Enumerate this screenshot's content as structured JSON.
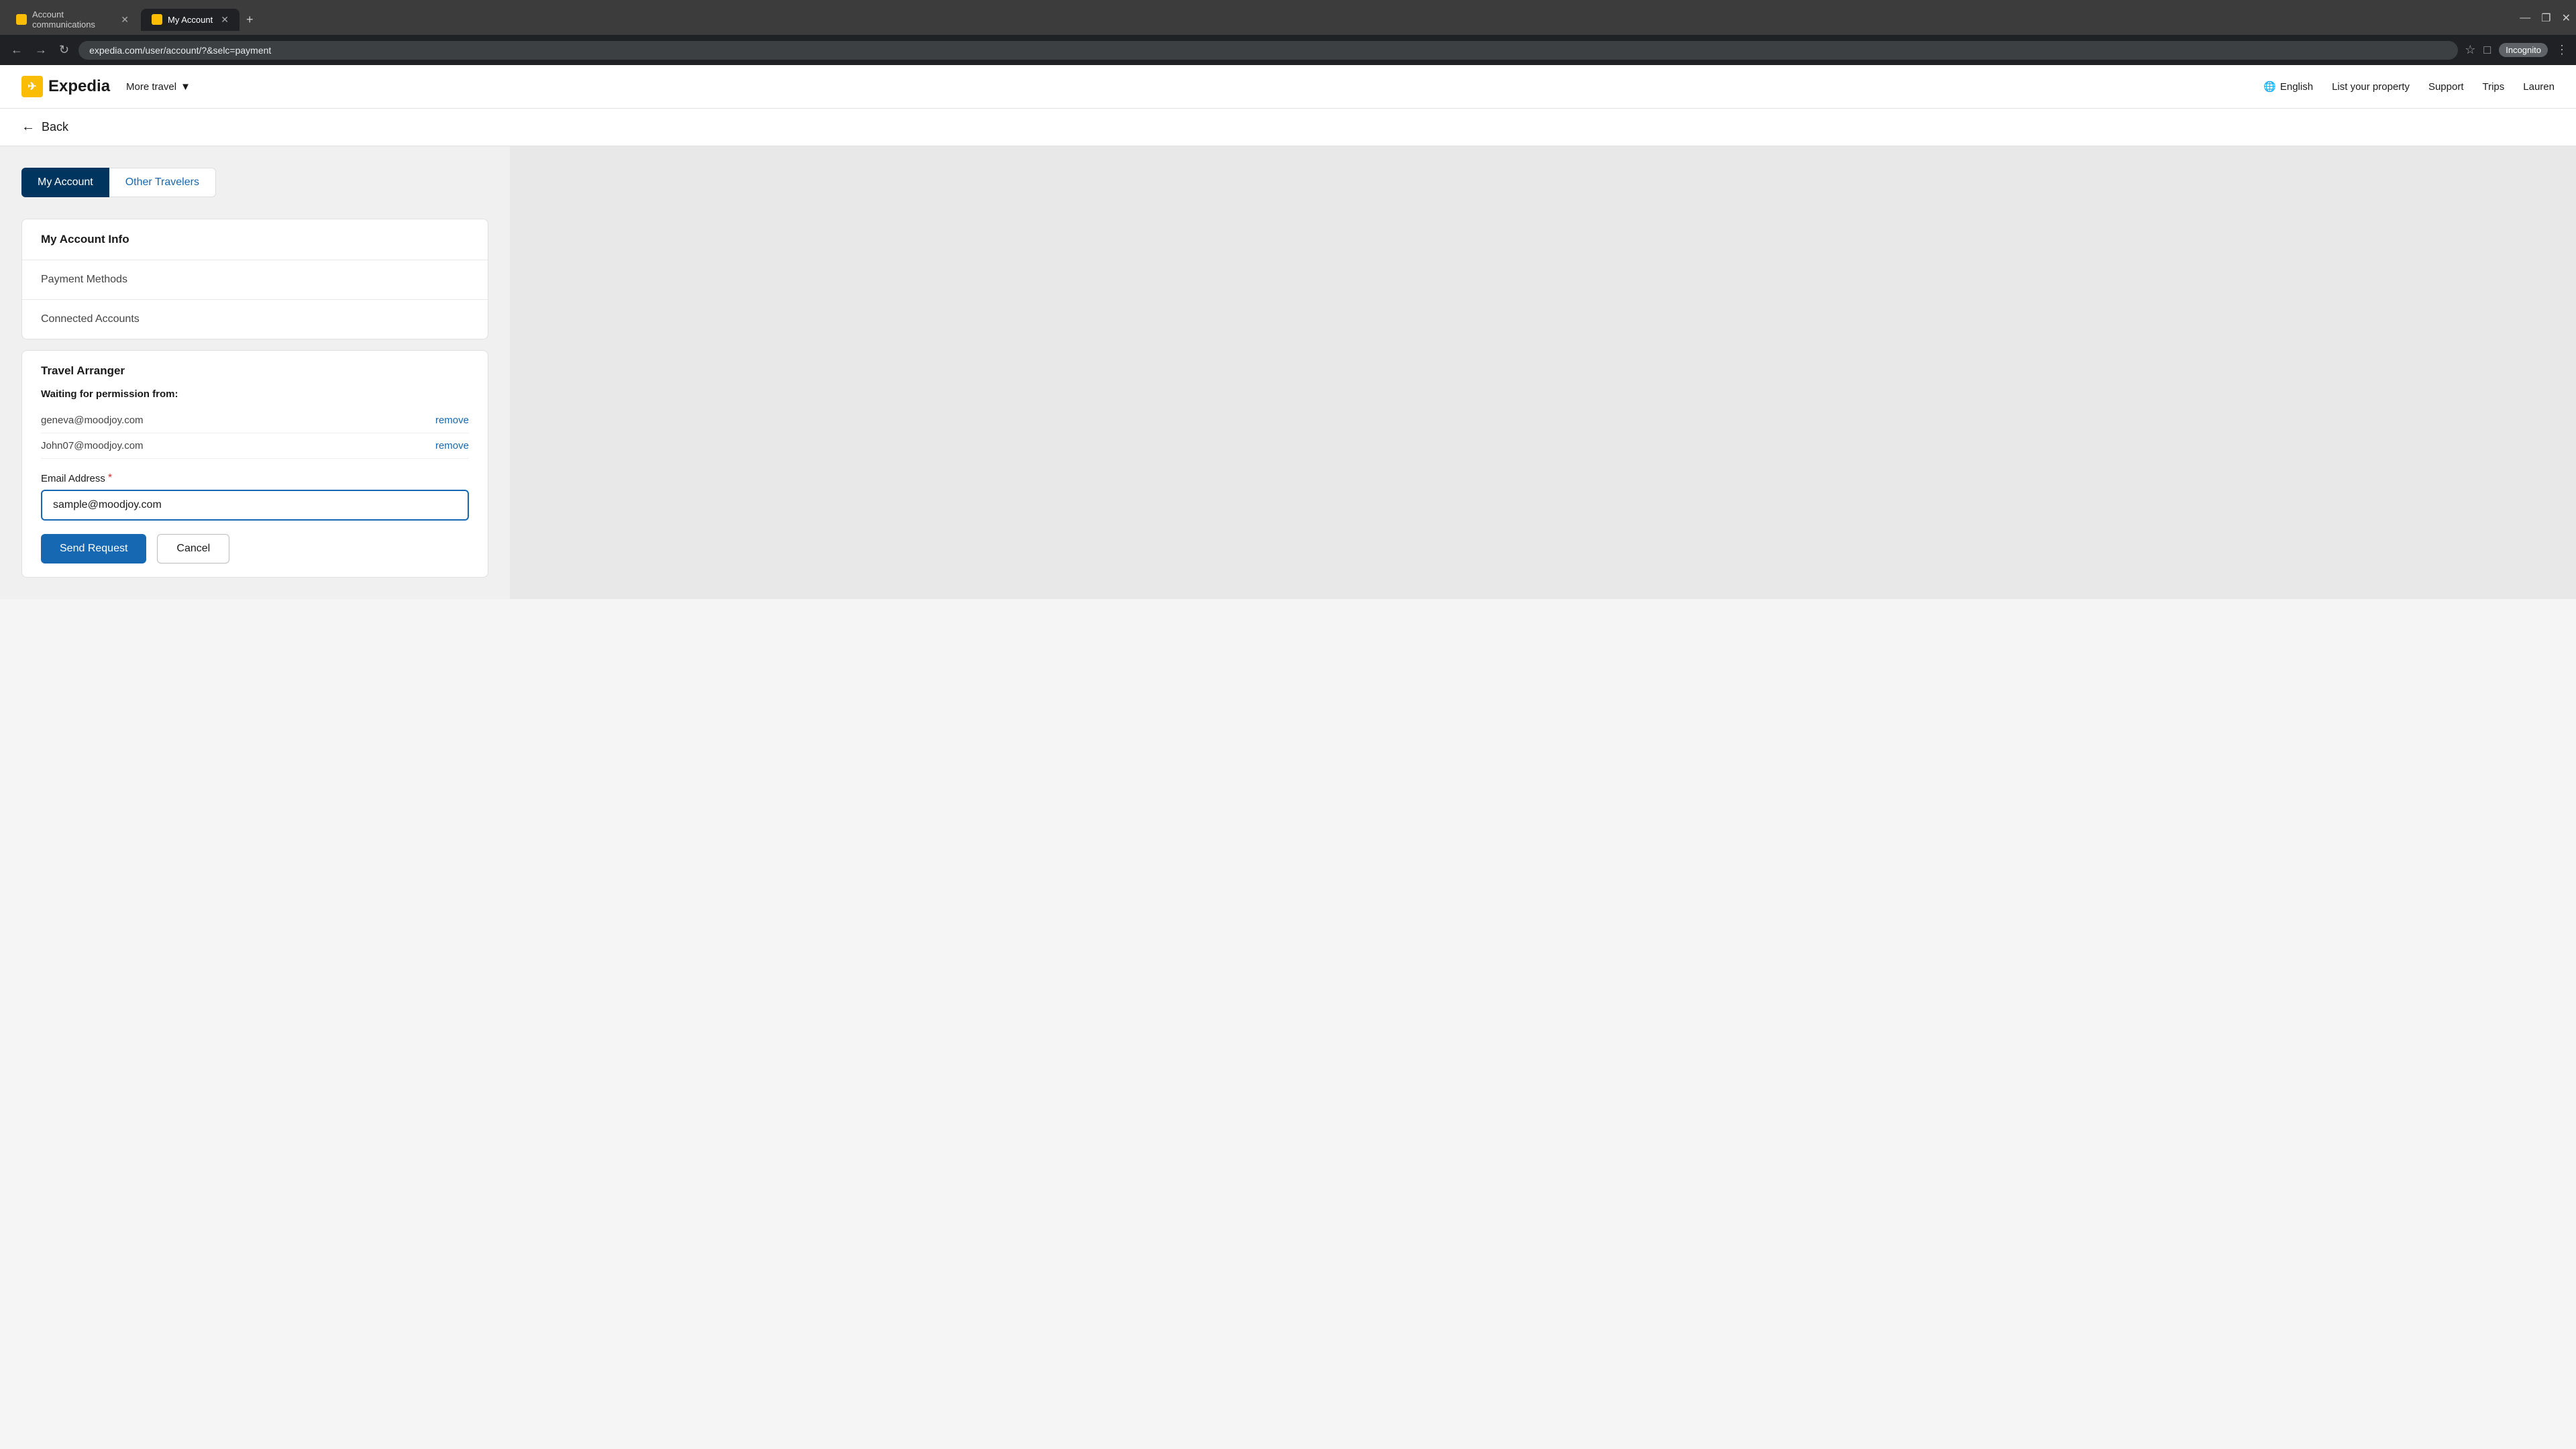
{
  "browser": {
    "tabs": [
      {
        "id": "tab1",
        "label": "Account communications",
        "active": false
      },
      {
        "id": "tab2",
        "label": "My Account",
        "active": true
      }
    ],
    "url": "expedia.com/user/account/?&selc=payment",
    "new_tab_label": "+",
    "incognito_label": "Incognito",
    "window_controls": {
      "minimize": "—",
      "restore": "❐",
      "close": "✕"
    }
  },
  "header": {
    "logo_text": "Expedia",
    "more_travel_label": "More travel",
    "nav_items": [
      {
        "id": "english",
        "label": "English",
        "has_globe": true
      },
      {
        "id": "list-property",
        "label": "List your property"
      },
      {
        "id": "support",
        "label": "Support"
      },
      {
        "id": "trips",
        "label": "Trips"
      },
      {
        "id": "account",
        "label": "Lauren"
      }
    ]
  },
  "back_bar": {
    "back_label": "Back"
  },
  "account_tabs": {
    "my_account_label": "My Account",
    "other_travelers_label": "Other Travelers"
  },
  "account_info": {
    "title": "My Account Info",
    "sections": [
      {
        "id": "payment",
        "label": "Payment Methods"
      },
      {
        "id": "connected",
        "label": "Connected Accounts"
      }
    ]
  },
  "travel_arranger": {
    "title": "Travel Arranger",
    "waiting_label": "Waiting for permission from:",
    "entries": [
      {
        "email": "geneva@moodjoy.com",
        "remove_label": "remove"
      },
      {
        "email": "John07@moodjoy.com",
        "remove_label": "remove"
      }
    ]
  },
  "email_form": {
    "label": "Email Address",
    "required_symbol": "*",
    "placeholder": "sample@moodjoy.com",
    "current_value": "sample@moodjoy.com",
    "send_button_label": "Send Request",
    "cancel_button_label": "Cancel"
  }
}
